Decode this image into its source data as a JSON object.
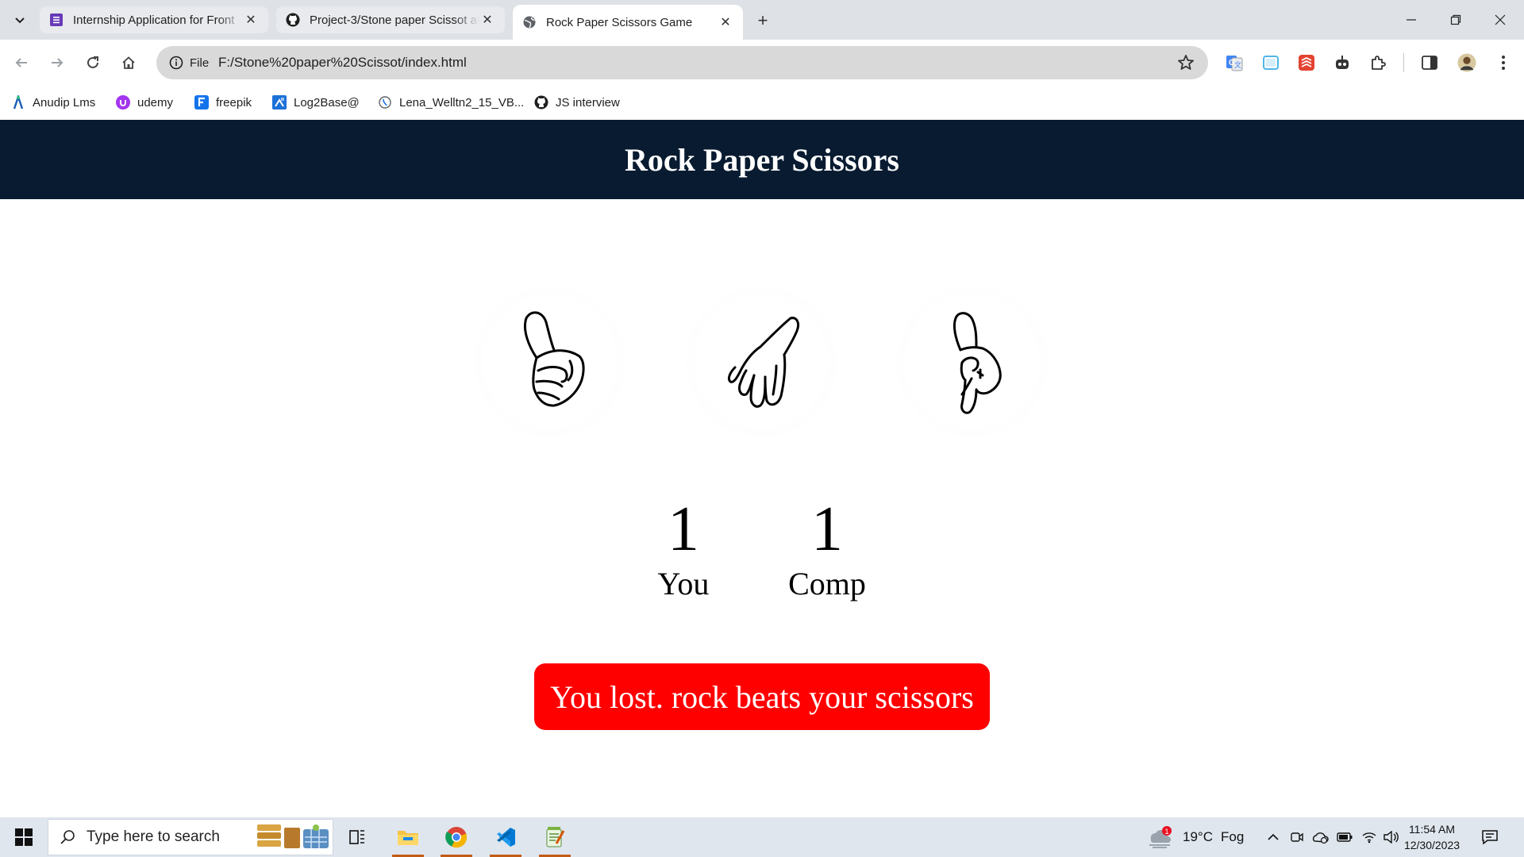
{
  "browser": {
    "tabs": [
      {
        "title": "Internship Application for Front",
        "favicon": "forms-icon"
      },
      {
        "title": "Project-3/Stone paper Scissot at",
        "favicon": "github-icon"
      },
      {
        "title": "Rock Paper Scissors Game",
        "favicon": "globe-icon"
      }
    ],
    "new_tab": "+",
    "address": {
      "chip": "File",
      "url": "F:/Stone%20paper%20Scissot/index.html"
    },
    "bookmarks": [
      {
        "label": "Anudip Lms",
        "icon": "anudip-icon"
      },
      {
        "label": "udemy",
        "icon": "udemy-icon"
      },
      {
        "label": "freepik",
        "icon": "freepik-icon"
      },
      {
        "label": "Log2Base@",
        "icon": "log2base-icon"
      },
      {
        "label": "Lena_Welltn2_15_VB...",
        "icon": "pdf-icon"
      },
      {
        "label": "JS interview",
        "icon": "github-icon"
      }
    ]
  },
  "page": {
    "title": "Rock Paper Scissors",
    "choices": [
      {
        "name": "rock"
      },
      {
        "name": "paper"
      },
      {
        "name": "scissors"
      }
    ],
    "scores": {
      "user": {
        "value": "1",
        "label": "You"
      },
      "comp": {
        "value": "1",
        "label": "Comp"
      }
    },
    "message": "You lost. rock beats your scissors",
    "colors": {
      "header": "#081b31",
      "message_bg": "#ff0000"
    }
  },
  "taskbar": {
    "search_placeholder": "Type here to search",
    "weather": {
      "temp": "19°C",
      "condition": "Fog",
      "badge": "1"
    },
    "time": "11:54 AM",
    "date": "12/30/2023"
  }
}
